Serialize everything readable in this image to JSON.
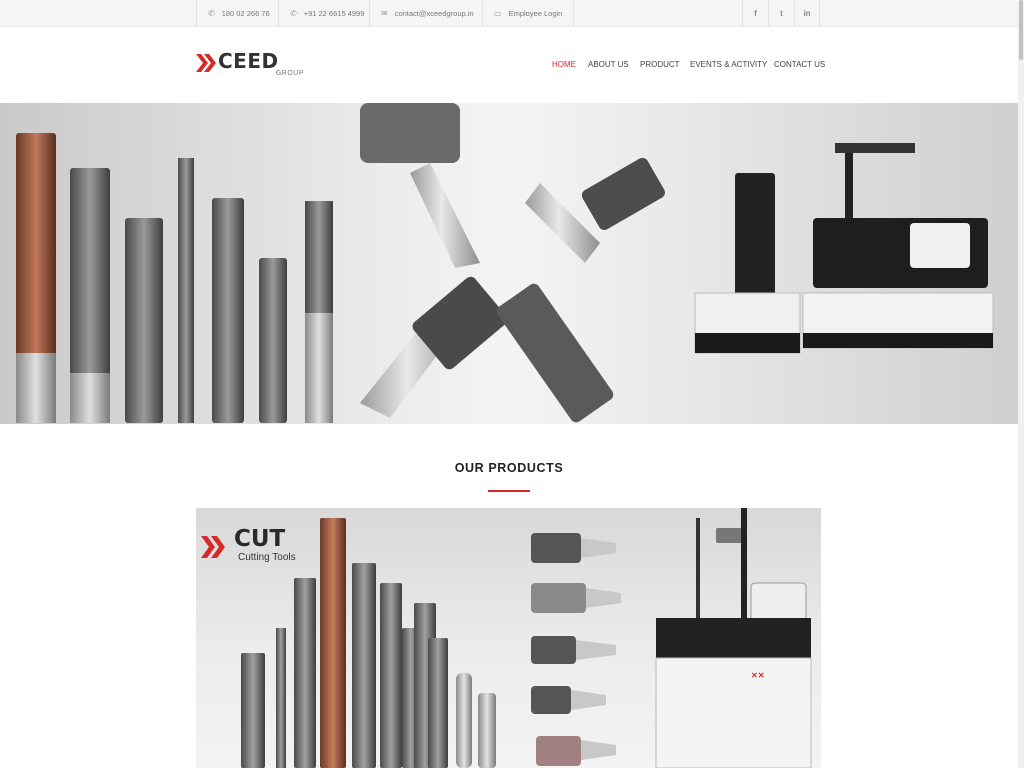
{
  "topbar": {
    "phone1": "180 02 266 76",
    "phone2": "+91 22 6615 4999",
    "email": "contact@xceedgroup.in",
    "employee_login": "Employee Login",
    "phone_icon": "phone-icon",
    "email_icon": "envelope-icon",
    "login_icon": "user-icon",
    "social": {
      "facebook": "f",
      "twitter": "t",
      "linkedin": "in"
    }
  },
  "header": {
    "logo_text": "CEED",
    "logo_sub": "GROUP",
    "nav": [
      "HOME",
      "ABOUT US",
      "PRODUCT",
      "EVENTS & ACTIVITY",
      "CONTACT US"
    ],
    "active_nav": "HOME"
  },
  "section": {
    "title": "OUR PRODUCTS"
  },
  "product": {
    "brand": "CUT",
    "tagline": "Cutting Tools",
    "machine_label": "CUT"
  },
  "colors": {
    "accent": "#d52b27",
    "topbar_bg": "#f5f5f5",
    "text": "#333333"
  }
}
